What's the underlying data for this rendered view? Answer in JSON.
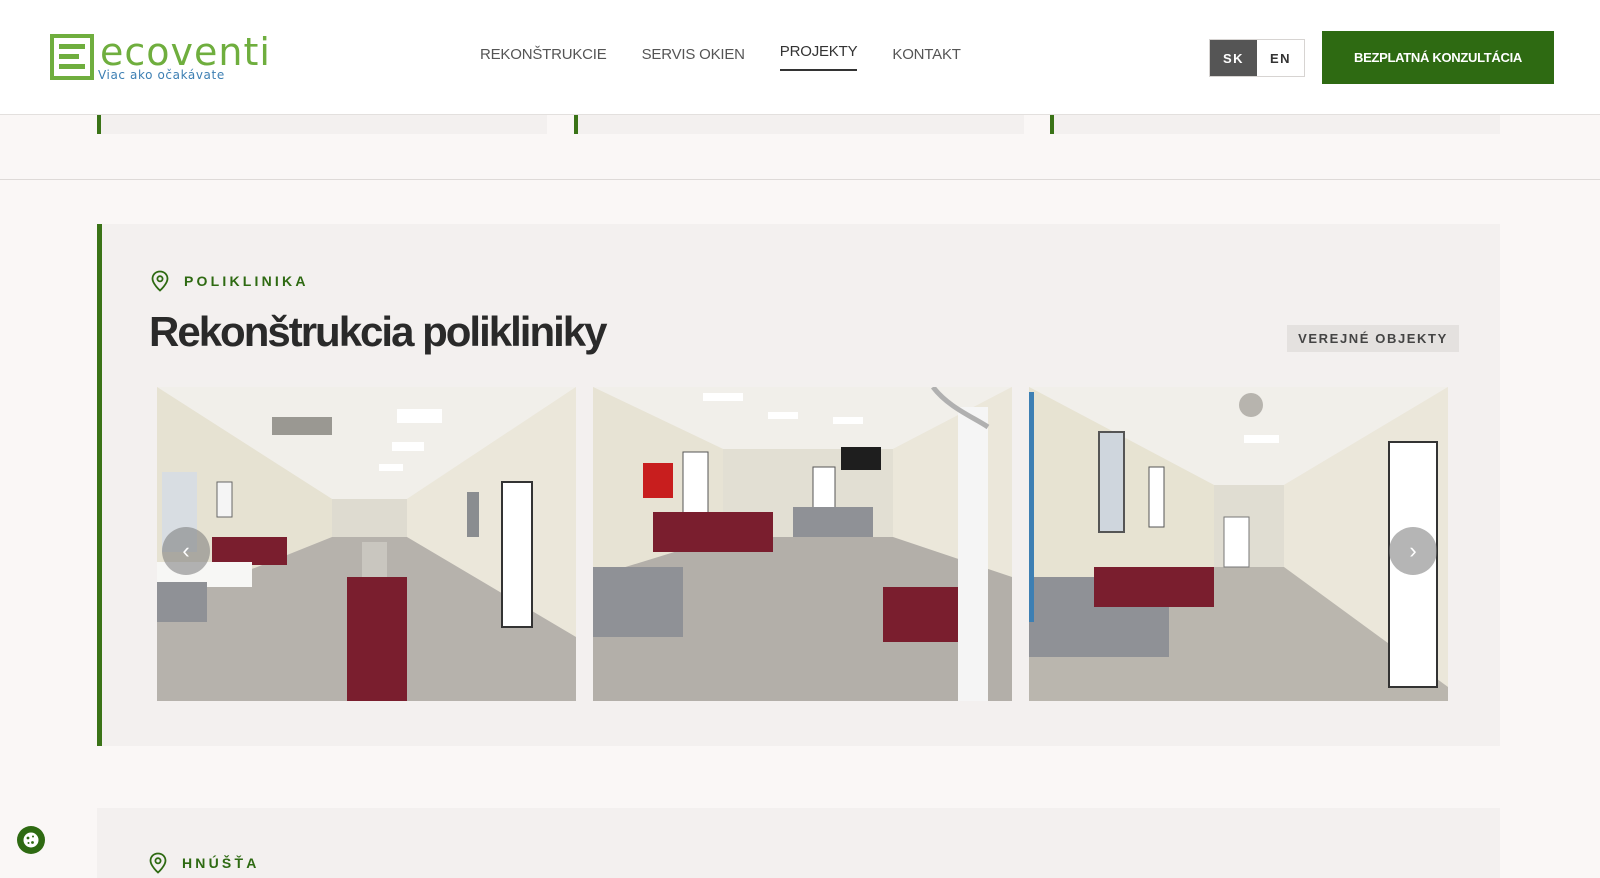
{
  "brand": {
    "name": "ecoventi",
    "tagline": "Viac ako očakávate",
    "accent": "#2e6a12",
    "logo_green": "#6fae3e",
    "logo_blue": "#3d7fb3"
  },
  "nav": {
    "items": [
      {
        "label": "REKONŠTRUKCIE",
        "active": false
      },
      {
        "label": "SERVIS OKIEN",
        "active": false
      },
      {
        "label": "PROJEKTY",
        "active": true
      },
      {
        "label": "KONTAKT",
        "active": false
      }
    ]
  },
  "lang": {
    "sk": "SK",
    "en": "EN",
    "selected": "SK"
  },
  "cta": {
    "label": "BEZPLATNÁ KONZULTÁCIA"
  },
  "project": {
    "location": "POLIKLINIKA",
    "title": "Rekonštrukcia polikliniky",
    "category": "VEREJNÉ OBJEKTY",
    "prev_icon": "chevron-left-icon",
    "next_icon": "chevron-right-icon",
    "prev_glyph": "‹",
    "next_glyph": "›"
  },
  "next_project": {
    "location": "HNÚŠŤA"
  }
}
